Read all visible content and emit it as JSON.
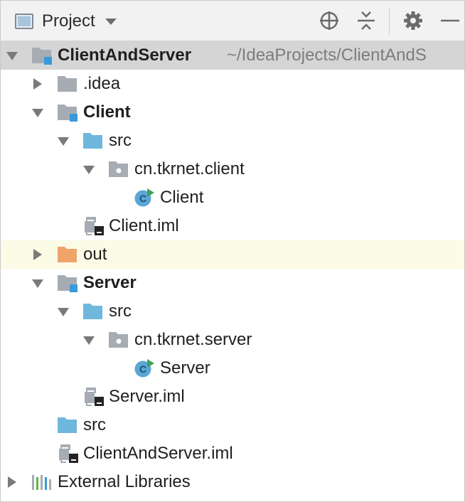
{
  "toolbar": {
    "title": "Project",
    "buttons": [
      "locate-icon",
      "collapse-all-icon",
      "gear-icon",
      "hide-icon"
    ]
  },
  "tree": {
    "root": {
      "label": "ClientAndServer",
      "path": "~/IdeaProjects/ClientAndS"
    },
    "idea": ".idea",
    "client_module": "Client",
    "client_src": "src",
    "client_package": "cn.tkrnet.client",
    "client_class": "Client",
    "client_iml": "Client.iml",
    "out": "out",
    "server_module": "Server",
    "server_src": "src",
    "server_package": "cn.tkrnet.server",
    "server_class": "Server",
    "server_iml": "Server.iml",
    "root_src": "src",
    "root_iml": "ClientAndServer.iml",
    "external_libraries": "External Libraries"
  },
  "colors": {
    "folder_gray": "#a6acb3",
    "folder_blue": "#6fb7dc",
    "folder_orange": "#f0a36a",
    "module_badge": "#3a9ad9",
    "class_circle": "#5aa7d6",
    "run_badge": "#3fa05a",
    "highlight_row": "#fbfbe6",
    "selected_row": "#d5d5d5"
  }
}
